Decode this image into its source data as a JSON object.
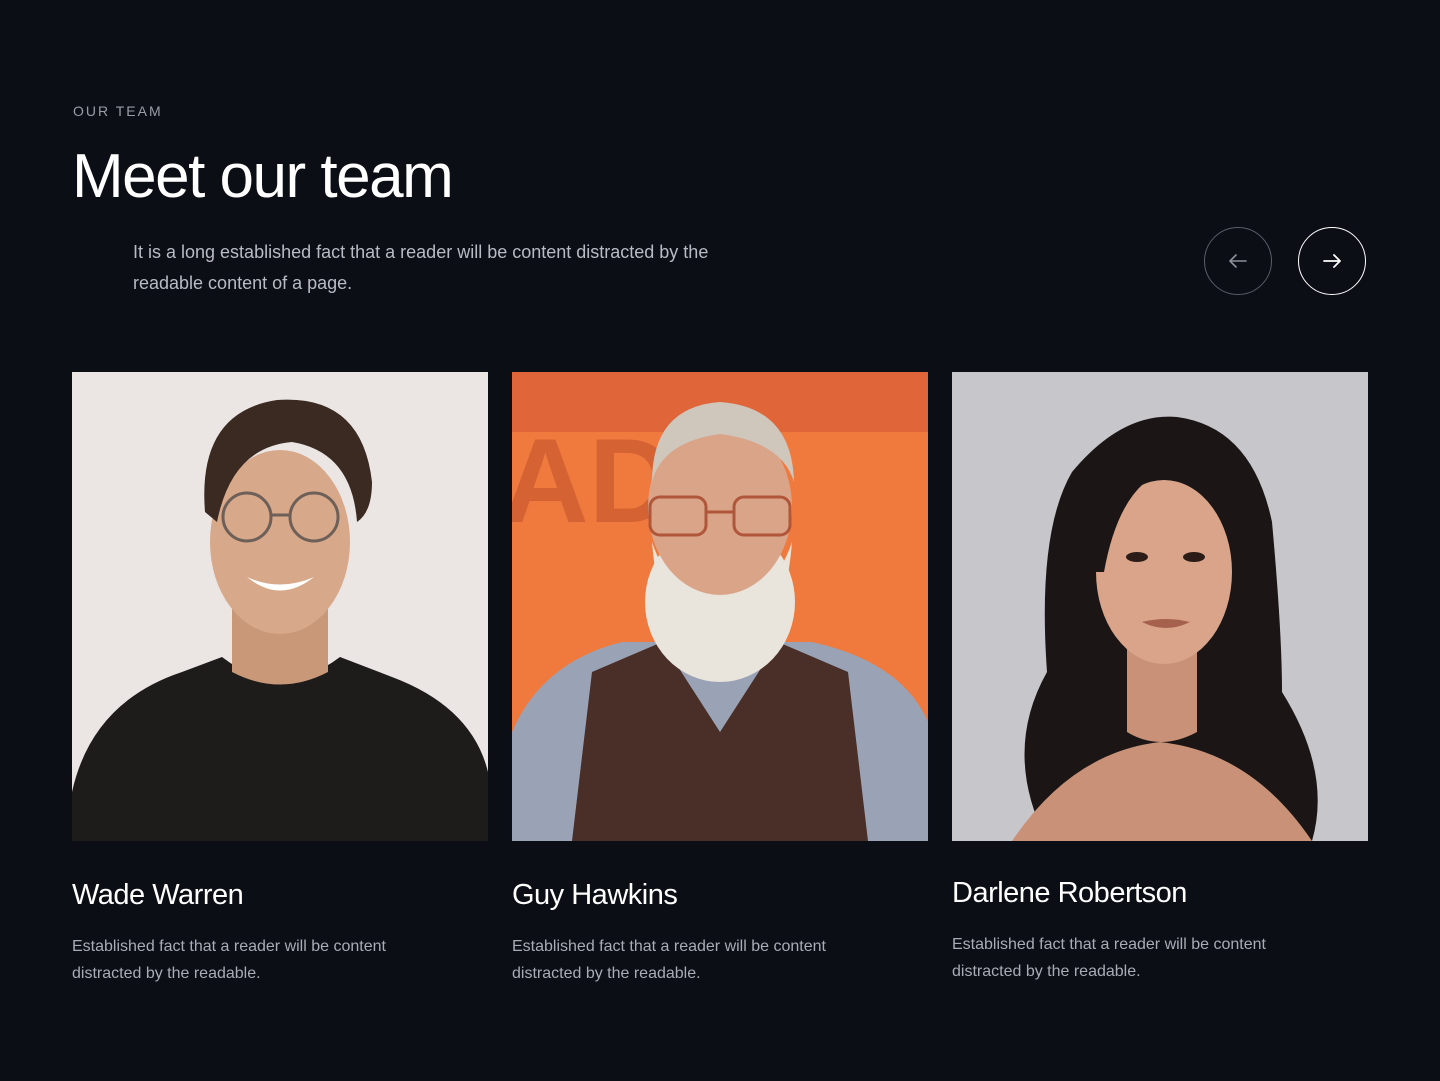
{
  "section": {
    "eyebrow": "OUR TEAM",
    "title": "Meet our team",
    "lead": "It is a long established fact that a reader will be content distracted by the readable content of a page."
  },
  "carousel": {
    "prev_icon": "arrow-left-icon",
    "next_icon": "arrow-right-icon"
  },
  "team": [
    {
      "name": "Wade Warren",
      "description": "Established fact that a reader will be content distracted by the readable.",
      "photo_bg": "#ebe6e4"
    },
    {
      "name": "Guy Hawkins",
      "description": "Established fact that a reader will be content distracted by the readable.",
      "photo_bg": "#f07a3e"
    },
    {
      "name": "Darlene Robertson",
      "description": "Established fact that a reader will be content distracted by the readable.",
      "photo_bg": "#c7c6cb"
    }
  ],
  "colors": {
    "background": "#0c0e16",
    "text_primary": "#ffffff",
    "text_muted": "#a9abb5"
  }
}
